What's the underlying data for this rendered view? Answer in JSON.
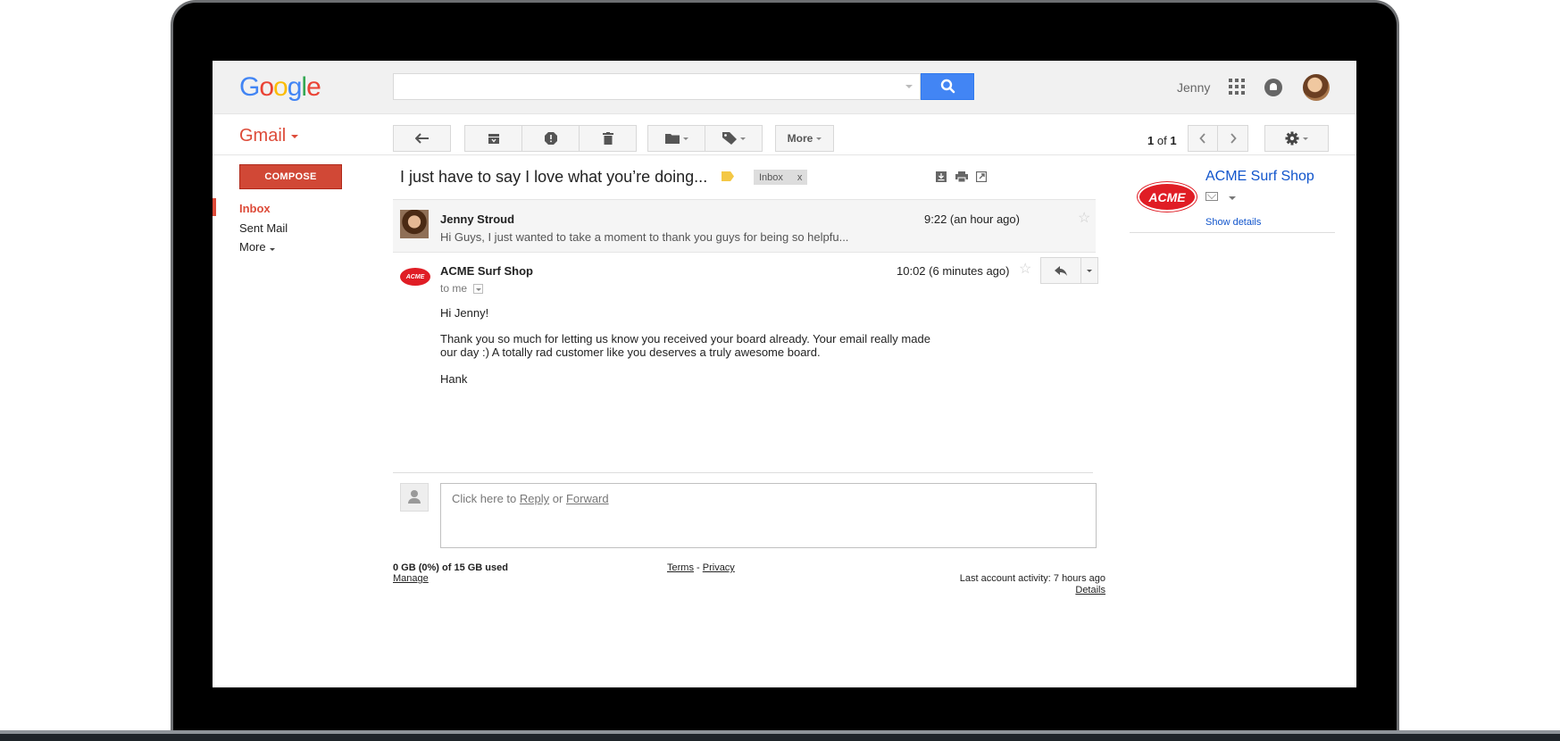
{
  "header": {
    "logo": "Google",
    "search": {
      "value": "",
      "placeholder": ""
    },
    "user_name": "Jenny"
  },
  "toolbar": {
    "app_label": "Gmail",
    "more_label": "More",
    "pager": {
      "current": "1",
      "of": "of",
      "total": "1"
    }
  },
  "nav": {
    "compose_label": "COMPOSE",
    "items": [
      {
        "label": "Inbox",
        "active": true
      },
      {
        "label": "Sent Mail",
        "active": false
      },
      {
        "label": "More",
        "active": false
      }
    ]
  },
  "thread": {
    "subject": "I just have to say I love what you’re doing...",
    "label_chip": "Inbox",
    "label_chip_close": "x",
    "messages": [
      {
        "sender": "Jenny Stroud",
        "time": "9:22 (an hour ago)",
        "snippet": "Hi Guys, I just wanted to take a moment to thank you guys for being so helpfu..."
      },
      {
        "sender": "ACME Surf Shop",
        "avatar_text": "ACME",
        "time": "10:02 (6 minutes ago)",
        "to": "to me",
        "body": {
          "greeting": "Hi Jenny!",
          "line1": "Thank you so much for letting us know you received your board already. Your email really made",
          "line2": "our day :) A totally rad customer like you deserves a truly awesome board.",
          "signature": "Hank"
        }
      }
    ],
    "reply_box": {
      "prefix": "Click here to",
      "reply": "Reply",
      "or": "or",
      "forward": "Forward"
    }
  },
  "footer": {
    "storage": "0 GB (0%) of 15 GB used",
    "manage": "Manage",
    "terms": "Terms",
    "separator": "-",
    "privacy": "Privacy",
    "activity": "Last account activity: 7 hours ago",
    "details": "Details"
  },
  "right_panel": {
    "logo_text": "ACME",
    "name": "ACME Surf Shop",
    "show_details": "Show details"
  },
  "colors": {
    "accent_red": "#dd4b39",
    "search_blue": "#4285f4",
    "link_blue": "#1155cc",
    "acme_red": "#e01d25",
    "label_yellow": "#f4c846"
  },
  "icons": [
    "search-icon",
    "apps-icon",
    "notifications-icon",
    "back-arrow-icon",
    "archive-icon",
    "report-spam-icon",
    "trash-icon",
    "folder-icon",
    "label-icon",
    "chevron-left-icon",
    "chevron-right-icon",
    "gear-icon",
    "print-icon",
    "download-icon",
    "new-window-icon",
    "star-icon",
    "reply-icon",
    "mail-icon",
    "person-icon"
  ]
}
